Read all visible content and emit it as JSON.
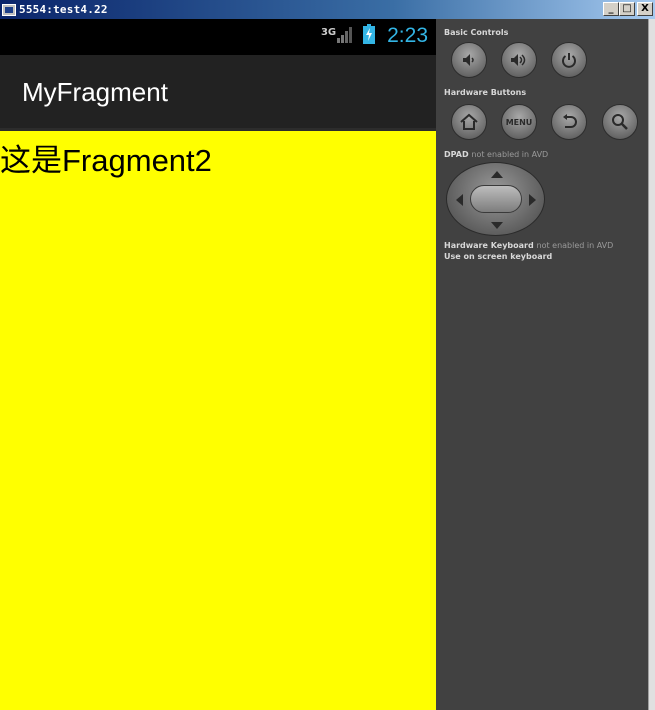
{
  "window": {
    "title": "5554:test4.22",
    "minimize_label": "_",
    "maximize_label": "□",
    "close_label": "X"
  },
  "statusbar": {
    "network_label": "3G",
    "time": "2:23",
    "time_color": "#33b5e5"
  },
  "app": {
    "title": "MyFragment",
    "fragment_text": "这是Fragment2",
    "content_background": "#ffff00"
  },
  "controls": {
    "basic_controls_label": "Basic Controls",
    "hardware_buttons_label": "Hardware Buttons",
    "menu_label": "MENU",
    "dpad_label": "DPAD",
    "dpad_note": "not enabled in AVD",
    "keyboard_label": "Hardware Keyboard",
    "keyboard_note": "not enabled in AVD",
    "keyboard_hint": "Use on screen keyboard",
    "icons": [
      "volume-down-icon",
      "volume-up-icon",
      "power-icon",
      "home-icon",
      "menu-icon",
      "back-icon",
      "search-icon"
    ]
  }
}
